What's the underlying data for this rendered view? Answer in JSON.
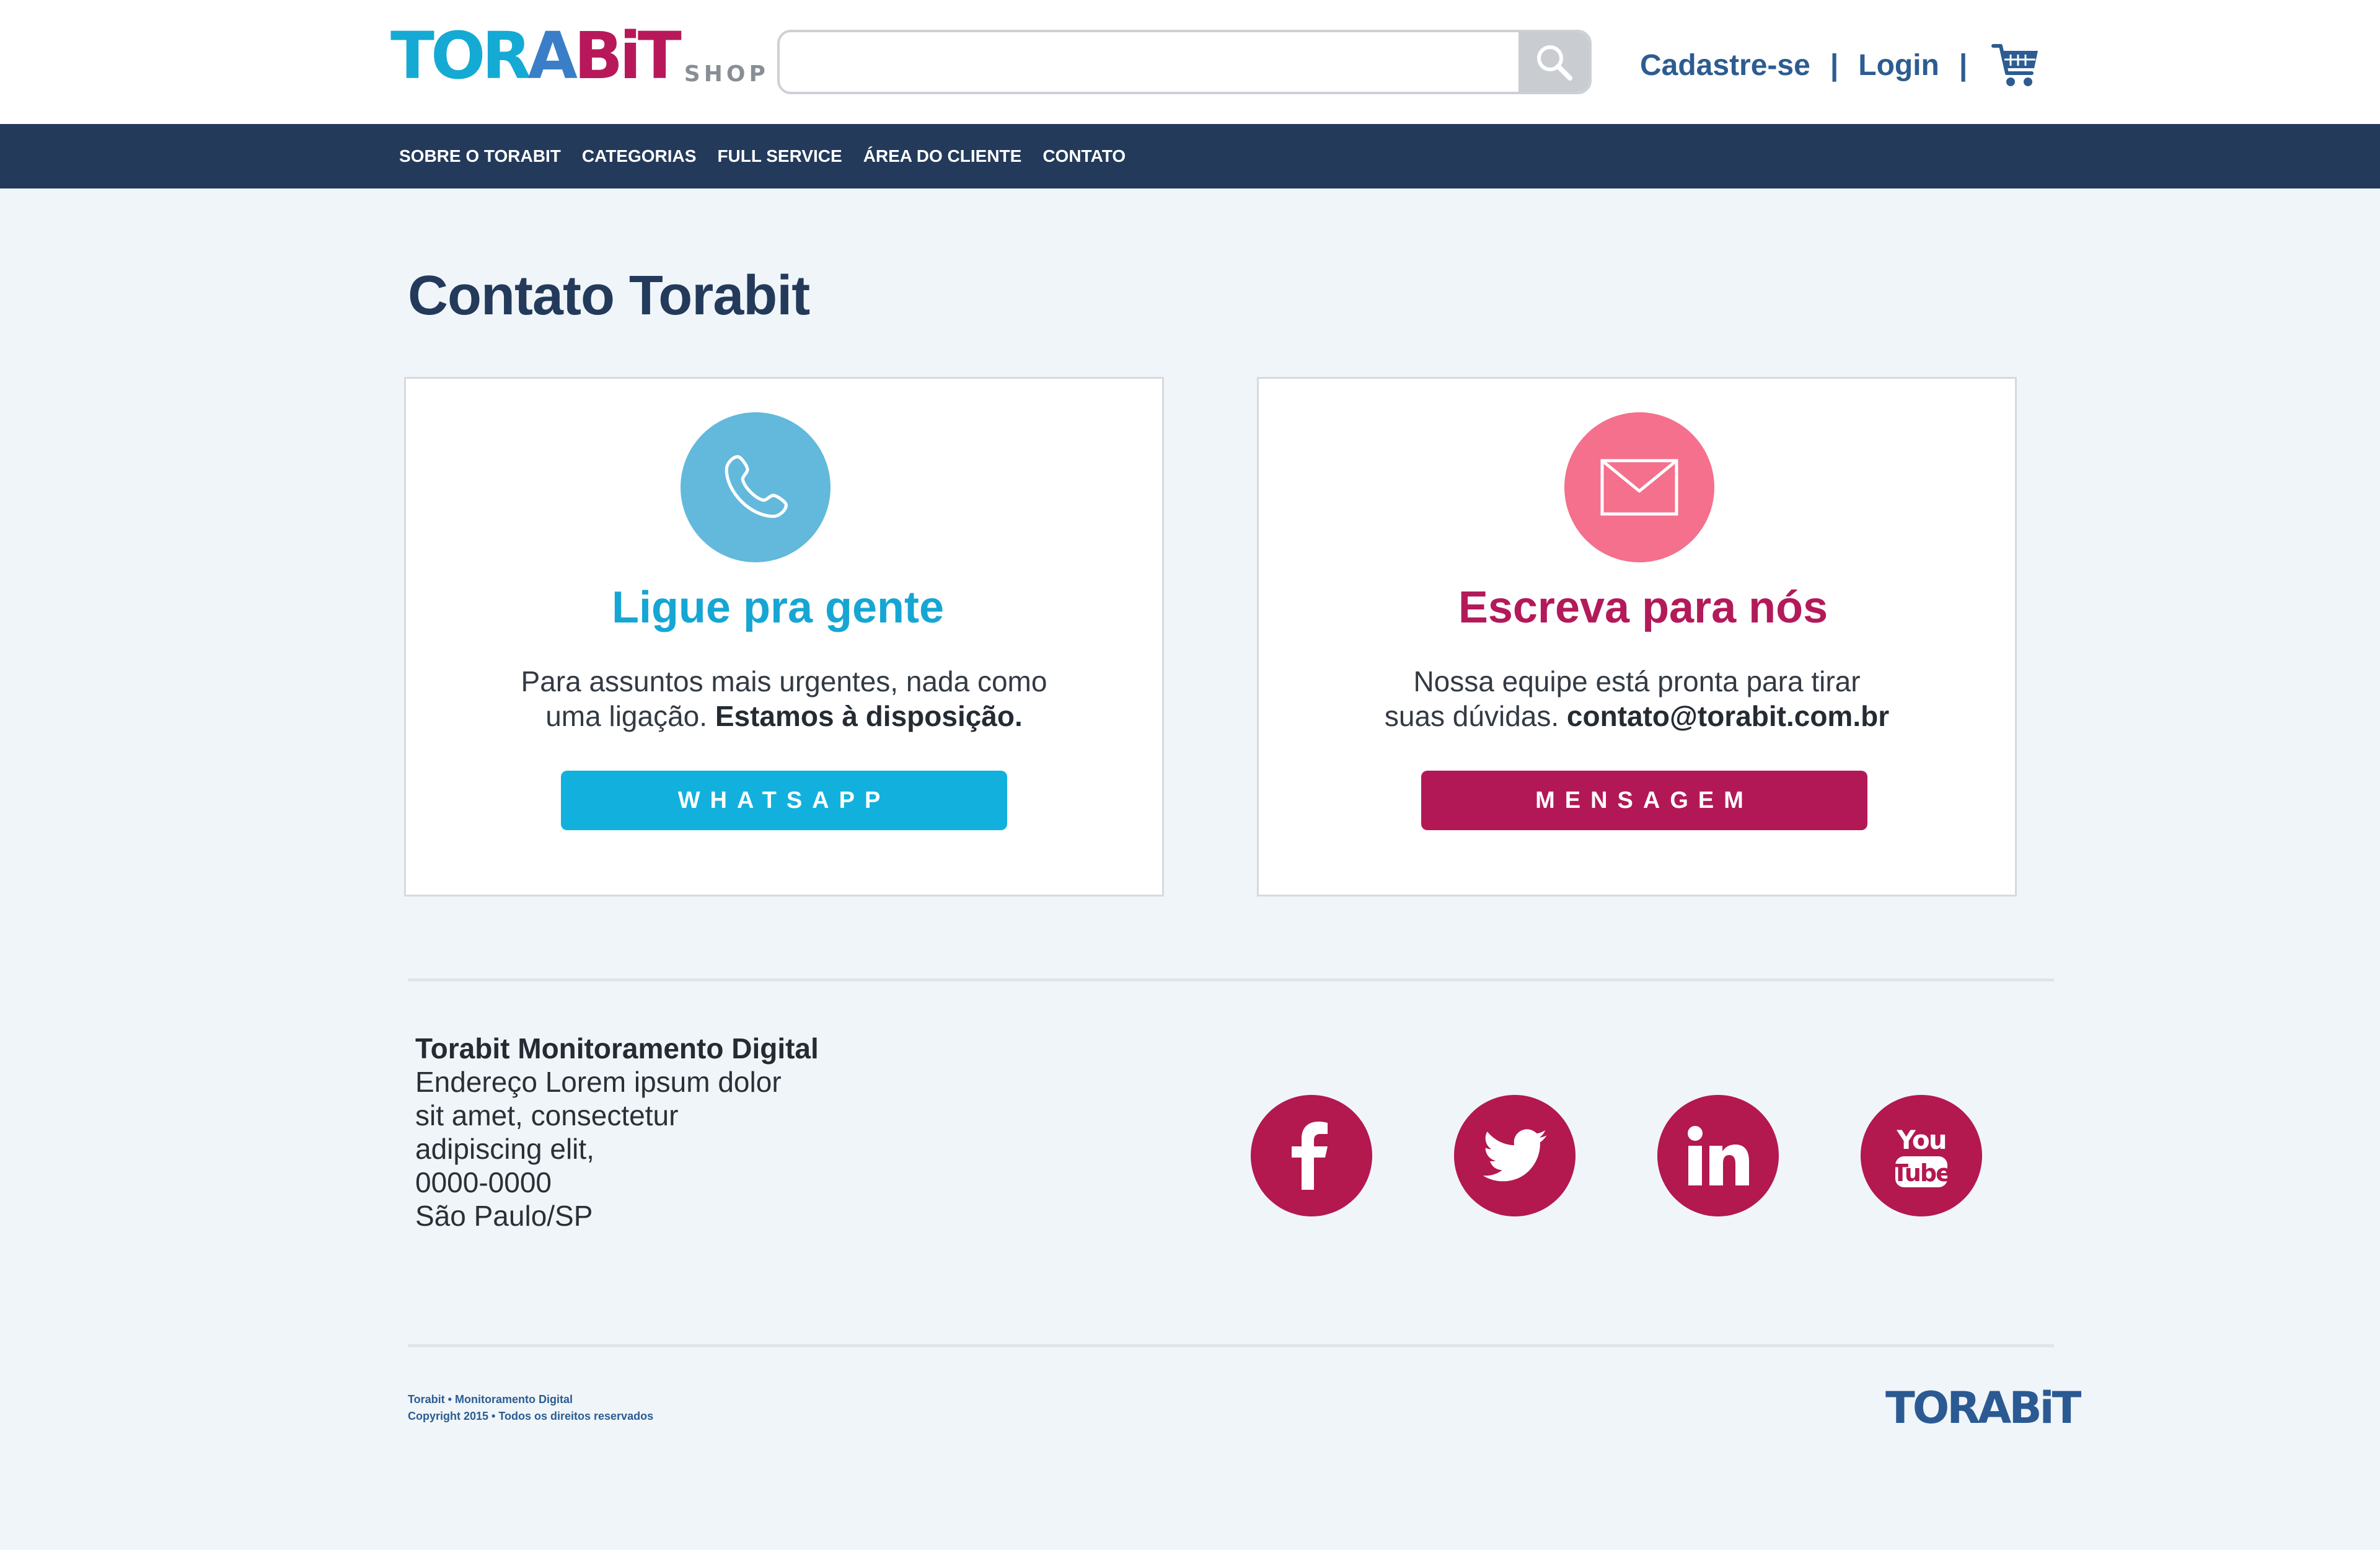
{
  "header": {
    "logo_text": "TORABiT",
    "logo_parts": [
      "TOR",
      "A",
      "BiT"
    ],
    "logo_sub": "SHOP",
    "search": {
      "value": "",
      "placeholder": ""
    },
    "signup_label": "Cadastre-se",
    "login_label": "Login",
    "separator": "|"
  },
  "nav": {
    "items": [
      "SOBRE O TORABIT",
      "CATEGORIAS",
      "FULL SERVICE",
      "ÁREA DO CLIENTE",
      "CONTATO"
    ]
  },
  "main": {
    "title": "Contato Torabit",
    "phone_card": {
      "icon": "phone-icon",
      "heading": "Ligue pra gente",
      "text_line1": "Para assuntos mais urgentes, nada como",
      "text_line2": "uma ligação.",
      "text_bold": "Estamos à disposição.",
      "button_label": "WHATSAPP"
    },
    "email_card": {
      "icon": "envelope-icon",
      "heading": "Escreva para nós",
      "text_line1": "Nossa equipe está pronta para tirar",
      "text_line2": "suas dúvidas.",
      "text_bold": "contato@torabit.com.br",
      "button_label": "MENSAGEM"
    }
  },
  "footer": {
    "address": {
      "company": "Torabit Monitoramento Digital",
      "line1": "Endereço Lorem ipsum dolor",
      "line2": "sit amet, consectetur",
      "line3": "adipiscing elit,",
      "line4": "0000-0000",
      "line5": "São Paulo/SP"
    },
    "social": [
      "facebook-icon",
      "twitter-icon",
      "linkedin-icon",
      "youtube-icon"
    ],
    "copyright_line1": "Torabit • Monitoramento Digital",
    "copyright_line2": "Copyright 2015 • Todos os direitos reservados",
    "logo_text": "TORABiT"
  },
  "colors": {
    "navy": "#233a5a",
    "cyan": "#12b1dd",
    "magenta": "#b21856",
    "pink": "#f4708c",
    "light_blue": "#62b9dc",
    "background": "#f0f5f9",
    "link_blue": "#2c5c91"
  }
}
